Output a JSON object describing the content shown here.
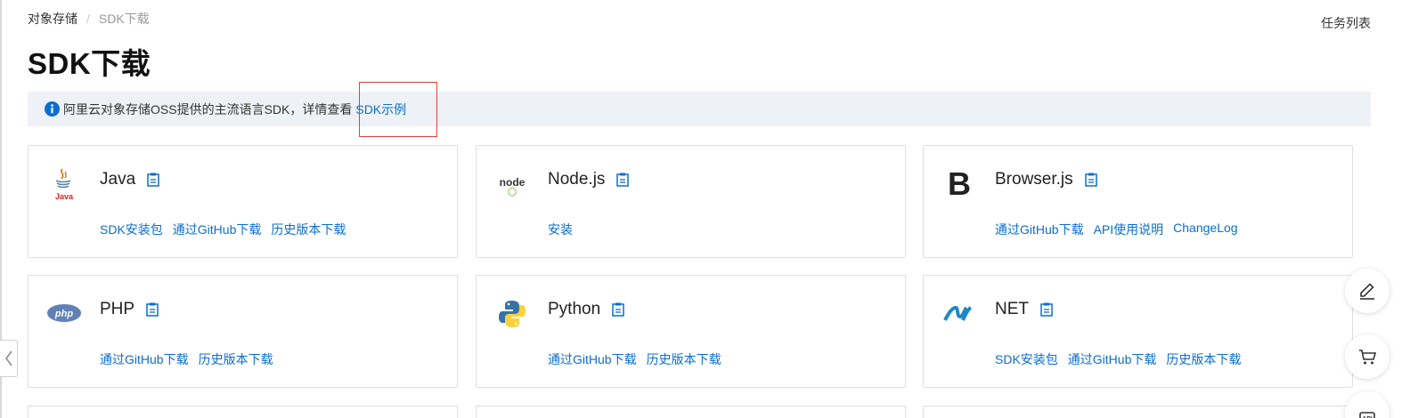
{
  "breadcrumb": {
    "first": "对象存储",
    "separator": "/",
    "current": "SDK下载"
  },
  "header": {
    "task_list": "任务列表",
    "title": "SDK下载"
  },
  "notice": {
    "text": "阿里云对象存储OSS提供的主流语言SDK，详情查看",
    "link": "SDK示例"
  },
  "colors": {
    "link": "#0a6ed1",
    "notice_bg": "#eef1f6",
    "highlight": "#e53e3e",
    "border": "#dcdfe6"
  },
  "sdks": [
    {
      "name": "Java",
      "icon": "java-logo-icon",
      "links": [
        "SDK安装包",
        "通过GitHub下载",
        "历史版本下载"
      ],
      "logo_text": "Java"
    },
    {
      "name": "Node.js",
      "icon": "nodejs-logo-icon",
      "links": [
        "安装"
      ],
      "logo_text": "node"
    },
    {
      "name": "Browser.js",
      "icon": "browserjs-logo-icon",
      "links": [
        "通过GitHub下载",
        "API使用说明",
        "ChangeLog"
      ],
      "logo_text": "B"
    },
    {
      "name": "PHP",
      "icon": "php-logo-icon",
      "links": [
        "通过GitHub下载",
        "历史版本下载"
      ],
      "logo_text": "php"
    },
    {
      "name": "Python",
      "icon": "python-logo-icon",
      "links": [
        "通过GitHub下载",
        "历史版本下载"
      ]
    },
    {
      "name": "NET",
      "icon": "dotnet-logo-icon",
      "links": [
        "SDK安装包",
        "通过GitHub下载",
        "历史版本下载"
      ]
    }
  ],
  "float_buttons": [
    {
      "icon": "edit-icon"
    },
    {
      "icon": "cart-icon"
    },
    {
      "icon": "api-icon"
    }
  ]
}
